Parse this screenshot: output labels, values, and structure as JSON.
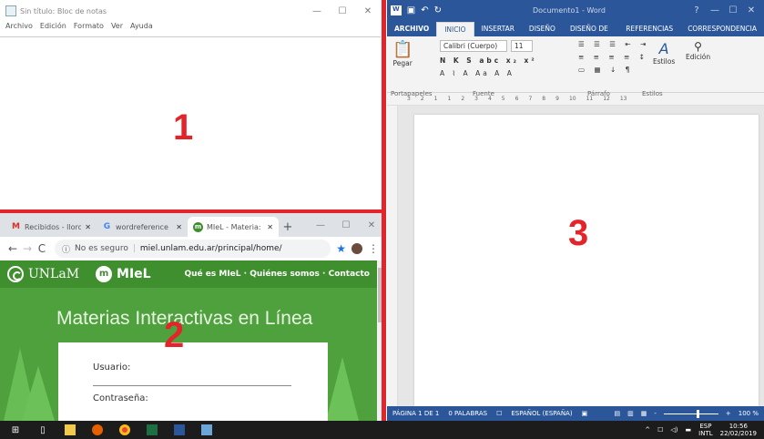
{
  "notepad": {
    "title": "Sin título: Bloc de notas",
    "menu": [
      "Archivo",
      "Edición",
      "Formato",
      "Ver",
      "Ayuda"
    ]
  },
  "chrome": {
    "tabs": [
      {
        "label": "Recibidos - llorc",
        "icon": "gmail-icon"
      },
      {
        "label": "wordreference",
        "icon": "google-icon"
      },
      {
        "label": "MIeL - Materia:",
        "icon": "miel-icon"
      }
    ],
    "security_label": "No es seguro",
    "url": "miel.unlam.edu.ar/principal/home/",
    "site": {
      "logo_unlam": "UNLaM",
      "logo_miel": "MIeL",
      "nav": "Qué es MIeL · Quiénes somos · Contacto",
      "hero_title": "Materias Interactivas en Línea",
      "usuario_label": "Usuario:",
      "password_label": "Contraseña:"
    }
  },
  "word": {
    "title": "Documento1 - Word",
    "tabs": [
      "ARCHIVO",
      "INICIO",
      "INSERTAR",
      "DISEÑO",
      "DISEÑO DE PÁGINA",
      "REFERENCIAS",
      "CORRESPONDENCIA"
    ],
    "font_name": "Calibri (Cuerpo)",
    "font_size": "11",
    "paste_label": "Pegar",
    "styles_label": "Estilos",
    "edit_label": "Edición",
    "groups": [
      "Portapapeles",
      "Fuente",
      "Párrafo",
      "Estilos"
    ],
    "ruler": [
      "3",
      "2",
      "1",
      "1",
      "2",
      "3",
      "4",
      "5",
      "6",
      "7",
      "8",
      "9",
      "10",
      "11",
      "12",
      "13"
    ],
    "status": {
      "page": "PÁGINA 1 DE 1",
      "words": "0 PALABRAS",
      "language": "ESPAÑOL (ESPAÑA)",
      "zoom": "100 %"
    }
  },
  "markers": {
    "one": "1",
    "two": "2",
    "three": "3"
  },
  "taskbar": {
    "lang": "ESP",
    "lang_sub": "INTL",
    "time": "10:56",
    "date": "22/02/2019"
  },
  "colors": {
    "divider": "#e3242b",
    "word_blue": "#2b579a",
    "miel_green": "#4fa13d"
  }
}
